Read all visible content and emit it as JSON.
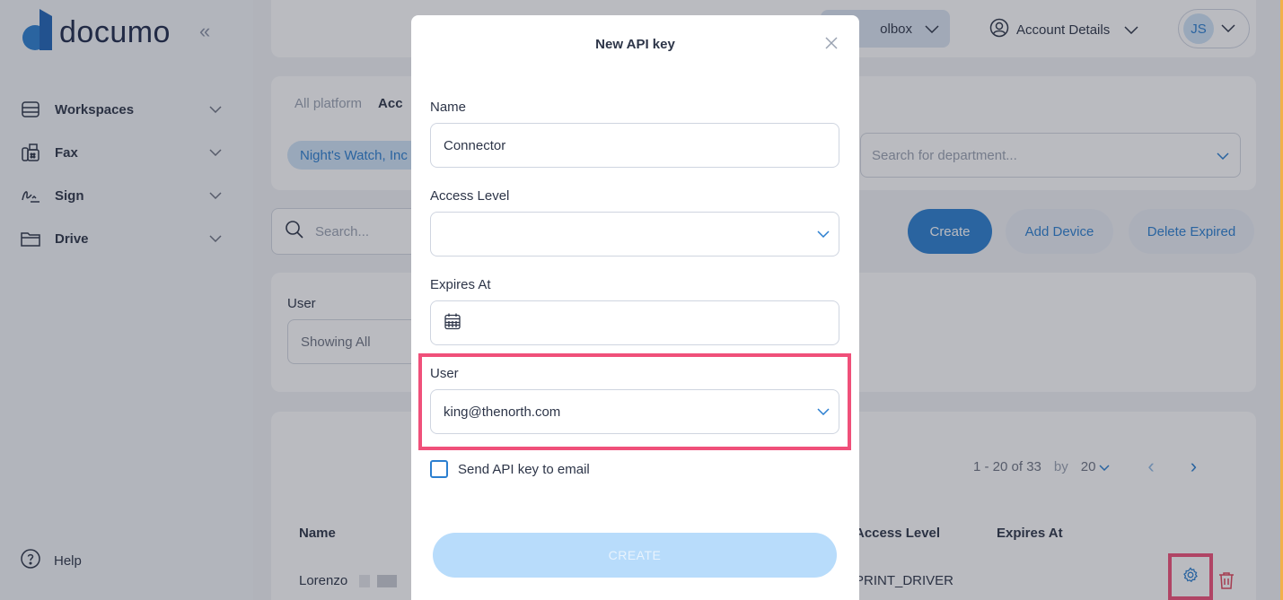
{
  "brand": {
    "name": "documo",
    "logo_color": "#2b7fd0"
  },
  "sidebar": {
    "collapse_glyph": "«",
    "items": [
      {
        "label": "Workspaces",
        "icon": "workspaces-icon"
      },
      {
        "label": "Fax",
        "icon": "fax-icon"
      },
      {
        "label": "Sign",
        "icon": "sign-icon"
      },
      {
        "label": "Drive",
        "icon": "drive-icon"
      }
    ],
    "help_label": "Help"
  },
  "topbar": {
    "toolbox_label": "olbox",
    "account_label": "Account Details",
    "user_initials": "JS"
  },
  "tabs": [
    "All platform",
    "Acc"
  ],
  "org_chip": "Night's Watch, Inc",
  "department_search": {
    "placeholder": "Search for department..."
  },
  "search": {
    "placeholder": "Search..."
  },
  "actions": {
    "create": "Create",
    "add_device": "Add Device",
    "delete_expired": "Delete Expired"
  },
  "filter": {
    "label": "User",
    "value": "Showing All"
  },
  "table": {
    "pagination": {
      "range": "1 - 20 of 33",
      "by": "by",
      "per_page": "20"
    },
    "columns": {
      "name": "Name",
      "access_level": "Access Level",
      "expires_at": "Expires At"
    },
    "rows": [
      {
        "name": "Lorenzo",
        "access_level": "PRINT_DRIVER"
      }
    ]
  },
  "modal": {
    "title": "New API key",
    "name_label": "Name",
    "name_value": "Connector",
    "access_level_label": "Access Level",
    "access_level_value": "",
    "expires_label": "Expires At",
    "user_label": "User",
    "user_value": "king@thenorth.com",
    "send_email_label": "Send API key to email",
    "submit_label": "CREATE"
  },
  "colors": {
    "accent": "#2b7fd0",
    "highlight": "#f0507a",
    "submit_disabled": "#b8dcfb"
  }
}
